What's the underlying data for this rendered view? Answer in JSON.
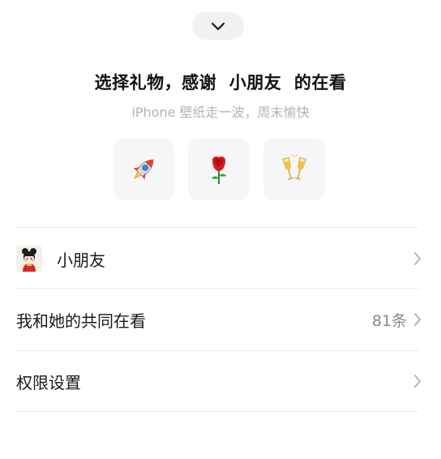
{
  "header": {
    "collapse_icon": "chevron-down-icon"
  },
  "gift_panel": {
    "title": "选择礼物，感谢  小朋友  的在看",
    "subtitle": "iPhone 壁纸走一波，周末愉快",
    "gifts": [
      {
        "icon": "rocket-icon"
      },
      {
        "icon": "rose-icon"
      },
      {
        "icon": "champagne-icon"
      }
    ]
  },
  "menu": {
    "friend": {
      "label": "小朋友",
      "avatar": "avatar-icon"
    },
    "shared_watch": {
      "label": "我和她的共同在看",
      "count": "81条"
    },
    "permissions": {
      "label": "权限设置"
    }
  },
  "colors": {
    "background": "#ffffff",
    "muted_text": "#b3b3b3",
    "secondary_text": "#888888",
    "button_bg": "#f6f6f6"
  }
}
